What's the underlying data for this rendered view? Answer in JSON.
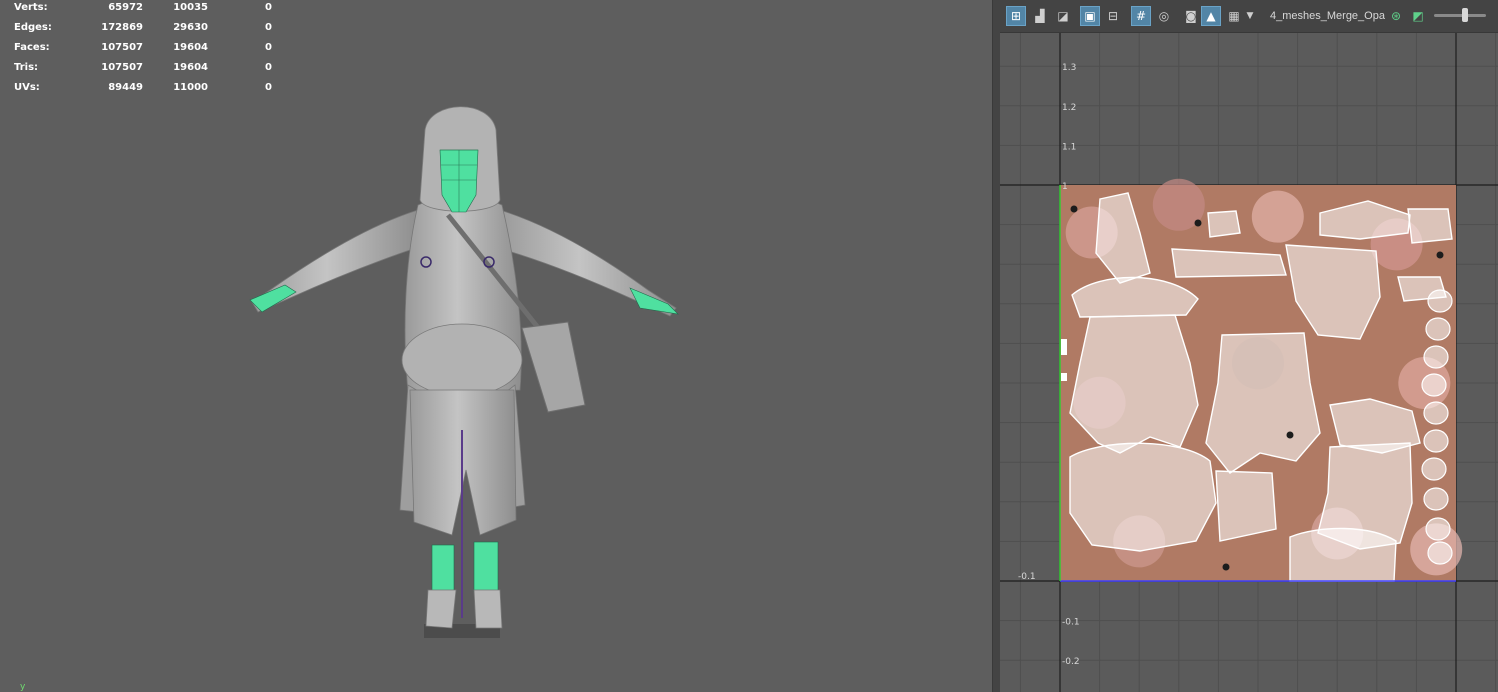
{
  "stats": {
    "rows": [
      {
        "label": "Verts:",
        "total": "65972",
        "selected": "10035",
        "extra": "0"
      },
      {
        "label": "Edges:",
        "total": "172869",
        "selected": "29630",
        "extra": "0"
      },
      {
        "label": "Faces:",
        "total": "107507",
        "selected": "19604",
        "extra": "0"
      },
      {
        "label": "Tris:",
        "total": "107507",
        "selected": "19604",
        "extra": "0"
      },
      {
        "label": "UVs:",
        "total": "89449",
        "selected": "11000",
        "extra": "0"
      }
    ]
  },
  "viewport": {
    "axis_indicator": "y",
    "colors": {
      "background": "#5e5e5e",
      "model": "#b8b8b8",
      "selection": "#4fe0a0"
    }
  },
  "uv_toolbar": {
    "buttons": [
      {
        "name": "uv-shell-select-icon",
        "active": true
      },
      {
        "name": "uv-component-select-icon",
        "active": false
      },
      {
        "name": "uv-shell-icon",
        "active": false
      },
      {
        "name": "wireframe-toggle-icon",
        "active": true
      },
      {
        "name": "uv-border-icon",
        "active": false
      },
      {
        "name": "grid-toggle-icon",
        "active": true
      },
      {
        "name": "pixel-snap-icon",
        "active": false
      },
      {
        "name": "snapshot-icon",
        "active": false
      },
      {
        "name": "image-display-icon",
        "active": true
      },
      {
        "name": "checker-icon",
        "active": false
      }
    ],
    "texture_name": "4_meshes_Merge_Opa",
    "slider_value": 0.6
  },
  "uv_editor": {
    "grid_labels": [
      {
        "text": "1.3",
        "v": 1.3
      },
      {
        "text": "1.2",
        "v": 1.2
      },
      {
        "text": "1.1",
        "v": 1.1
      },
      {
        "text": "1",
        "v": 1.0
      },
      {
        "text": "-0.1",
        "v": -0.1
      },
      {
        "text": "-0.2",
        "v": -0.2
      }
    ],
    "corner_label": "-0.1",
    "colors": {
      "background": "#5b5b5b",
      "texture_base": "#b07a64",
      "wire": "#ffffff",
      "axis_u": "#4040ff",
      "axis_v": "#33cc33"
    }
  }
}
